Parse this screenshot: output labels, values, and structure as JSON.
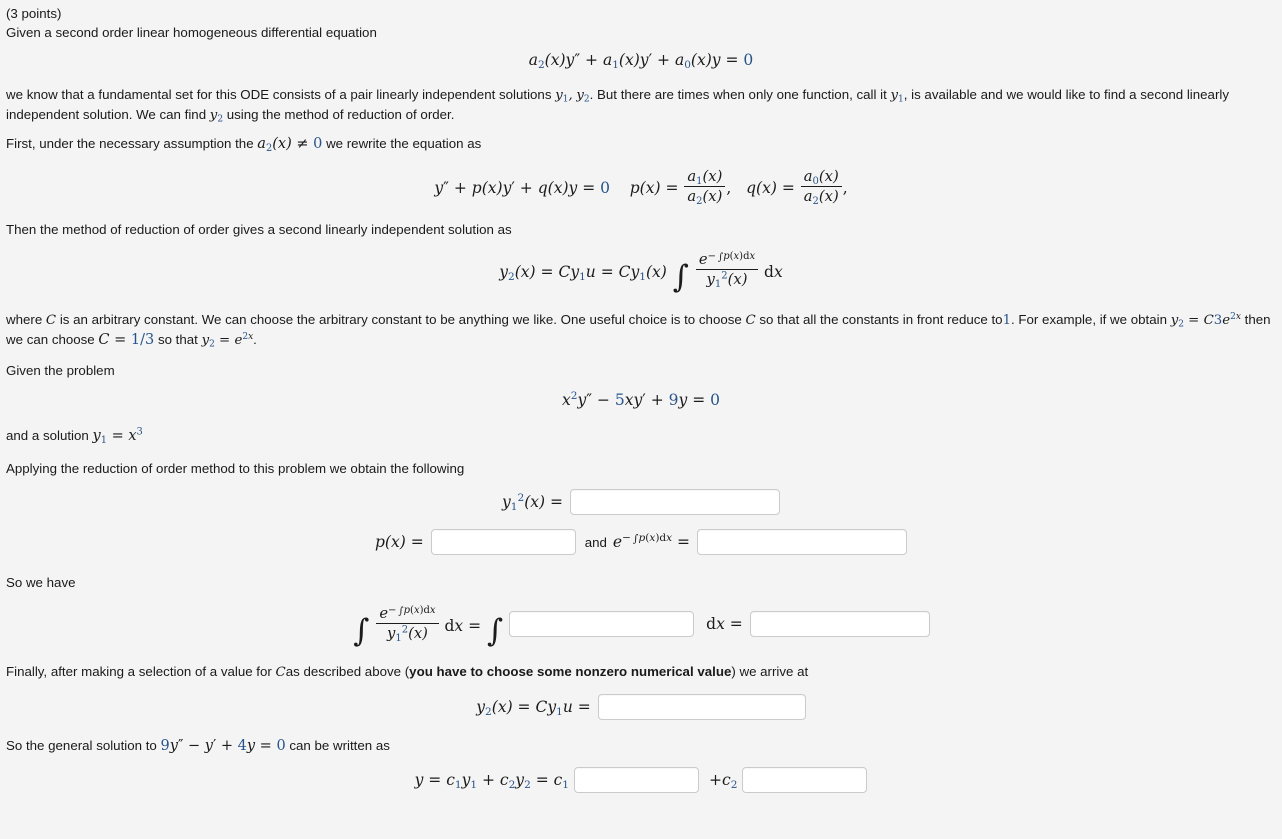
{
  "header": {
    "points": "(3 points)",
    "intro_line": "Given a second order linear homogeneous differential equation"
  },
  "equations": {
    "general_ode": "a2(x)y'' + a1(x)y' + a0(x)y = 0",
    "standard_form": "y'' + p(x)y' + q(x)y = 0   p(x) = a1(x)/a2(x),  q(x) = a0(x)/a2(x),",
    "reduction_formula": "y2(x) = Cy1u = Cy1(x) ∫ e^(-∫p(x)dx) / y1^2(x) dx",
    "problem_ode": "x^2 y'' - 5xy' + 9y = 0",
    "given_solution": "y1 = x^3",
    "general_solution_ode": "9y'' - y' + 4y = 0"
  },
  "paragraphs": {
    "fundamental_set_a": "we know that a fundamental set for this ODE consists of a pair linearly independent solutions",
    "fundamental_set_b": ". But there are times when only one function, call it",
    "fundamental_set_c": ", is available and we would like to find a second linearly",
    "fundamental_set_d": "independent solution. We can find",
    "fundamental_set_e": "using the method of reduction of order.",
    "assumption_a": "First, under the necessary assumption the",
    "assumption_b": "we rewrite the equation as",
    "method_line": "Then the method of reduction of order gives a second linearly independent solution as",
    "constant_a": "where",
    "constant_b": "is an arbitrary constant. We can choose the arbitrary constant to be anything we like. One useful choice is to choose",
    "constant_c": "so that all the constants in front reduce to",
    "constant_d": ". For example, if we obtain",
    "constant_e": "then",
    "constant_f": "we can choose",
    "constant_g": "so that",
    "constant_h": ".",
    "given_problem": "Given the problem",
    "and_a_solution": "and a solution",
    "applying": "Applying the reduction of order method to this problem we obtain the following",
    "so_we_have": "So we have",
    "finally_a": "Finally, after making a selection of a value for",
    "finally_b": "as described above (",
    "finally_bold": "you have to choose some nonzero numerical value",
    "finally_c": ") we arrive at",
    "general_solution_a": "So the general solution to",
    "general_solution_b": "can be written as",
    "and_word": "and"
  },
  "fields": {
    "y1sq": {
      "label": "y1^2(x) =",
      "value": "",
      "placeholder": ""
    },
    "px": {
      "label": "p(x) =",
      "value": "",
      "placeholder": ""
    },
    "exp_int": {
      "label": "e^(-∫p(x)dx) =",
      "value": "",
      "placeholder": ""
    },
    "integrand": {
      "label": "∫ e^(-∫p(x)dx)/y1^2(x) dx = ∫",
      "value": "",
      "placeholder": ""
    },
    "integral_result": {
      "label": "dx =",
      "value": "",
      "placeholder": ""
    },
    "y2": {
      "label": "y2(x) = Cy1u =",
      "value": "",
      "placeholder": ""
    },
    "c1_term": {
      "label": "y = c1y1 + c2y2 = c1",
      "value": "",
      "placeholder": ""
    },
    "c2_term": {
      "label": "+c2",
      "value": "",
      "placeholder": ""
    }
  },
  "colors": {
    "page_background": "#f4f4f4",
    "text": "#1a1a1a",
    "math_number": "#27548a",
    "input_border": "#cbcbcb",
    "input_background": "#ffffff"
  }
}
